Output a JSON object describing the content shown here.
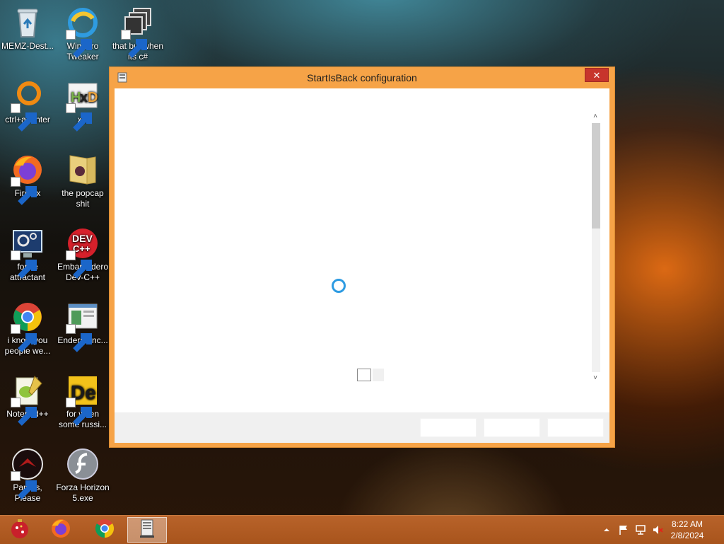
{
  "desktop": {
    "icons": [
      {
        "label": "MEMZ-Dest...",
        "icon": "recycle-bin-icon"
      },
      {
        "label": "Winaero Tweaker",
        "icon": "winaero-icon"
      },
      {
        "label": "that but when its c#",
        "icon": "stack-windows-icon"
      },
      {
        "label": "ctrl+a, enter",
        "icon": "orange-ring-icon"
      },
      {
        "label": "xD",
        "icon": "hxd-icon"
      },
      {
        "label": "Firefox",
        "icon": "firefox-icon"
      },
      {
        "label": "the popcap shit",
        "icon": "folder-icon"
      },
      {
        "label": "forkie attractant",
        "icon": "settings-monitor-icon"
      },
      {
        "label": "Embarcadero Dev-C++",
        "icon": "devcpp-icon"
      },
      {
        "label": "i know you people we...",
        "icon": "chrome-icon"
      },
      {
        "label": "Endermanc...",
        "icon": "window-screenshot-icon"
      },
      {
        "label": "Notepad++",
        "icon": "notepadpp-icon"
      },
      {
        "label": "for when some russi...",
        "icon": "de-icon"
      },
      {
        "label": "Papers, Please",
        "icon": "papers-please-icon"
      },
      {
        "label": "Forza Horizon 5.exe",
        "icon": "flash-icon"
      }
    ]
  },
  "window": {
    "title": "StartIsBack configuration",
    "close_glyph": "✕"
  },
  "taskbar": {
    "items": [
      "ornament-icon",
      "firefox-icon",
      "chrome-icon",
      "startisback-icon"
    ],
    "tray": [
      "show-hidden-icon",
      "flag-icon",
      "network-icon",
      "volume-muted-icon"
    ],
    "time": "8:22 AM",
    "date": "2/8/2024"
  },
  "colors": {
    "window_frame": "#f6a347",
    "close_button": "#c7352c",
    "taskbar": "#b05c22",
    "spinner": "#2d9be2"
  }
}
